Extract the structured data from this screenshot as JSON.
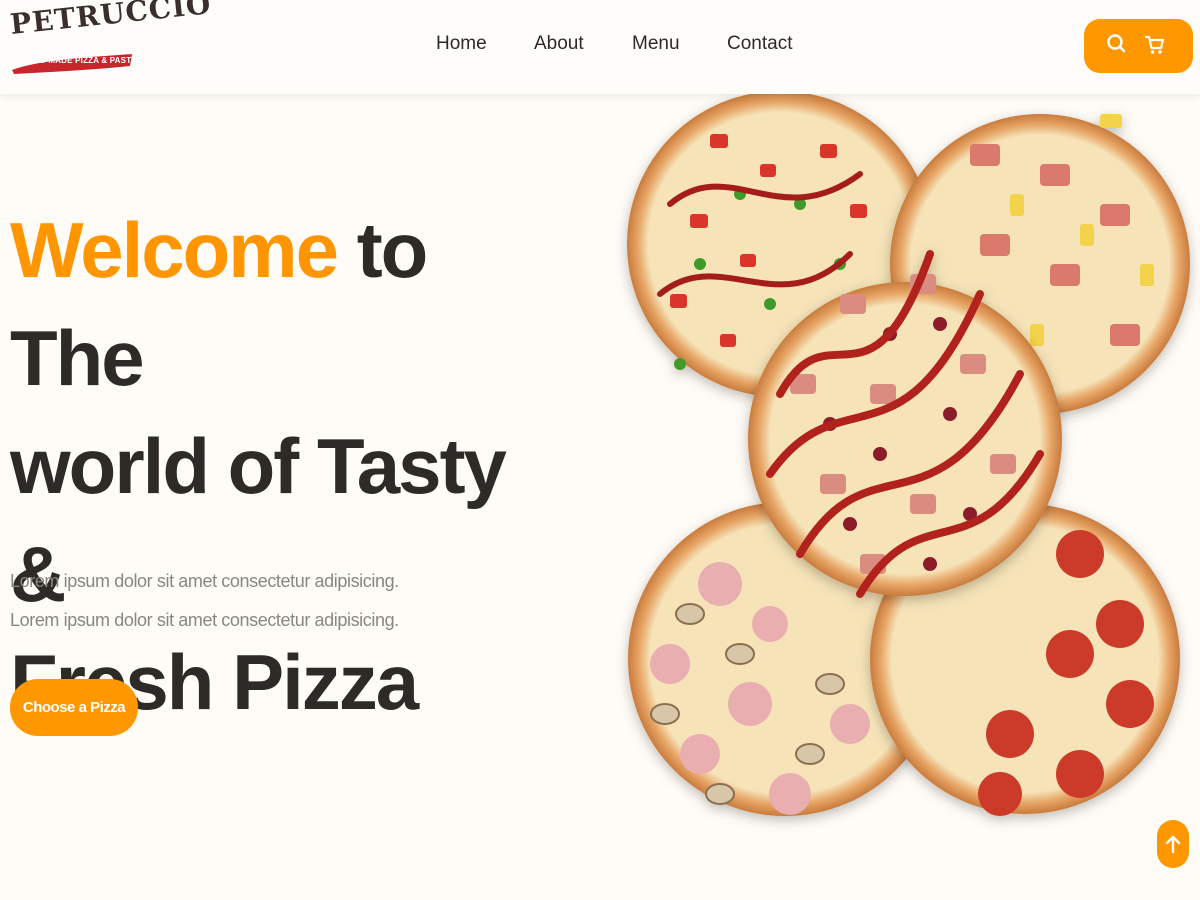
{
  "brand": {
    "name": "PETRUCCIO",
    "tagline": "HAND MADE PIZZA & PASTA"
  },
  "nav": {
    "items": [
      {
        "label": "Home"
      },
      {
        "label": "About"
      },
      {
        "label": "Menu"
      },
      {
        "label": "Contact"
      }
    ]
  },
  "header_actions": {
    "icons": [
      "search-icon",
      "cart-icon"
    ]
  },
  "hero": {
    "title_accent": "Welcome",
    "title_line1_rest": " to The",
    "title_line2": "world of Tasty &",
    "title_line3": "Fresh Pizza",
    "text_line1": "Lorem ipsum dolor sit amet consectetur adipisicing.",
    "text_line2": "Lorem ipsum dolor sit amet consectetur adipisicing.",
    "cta_label": "Choose a Pizza"
  },
  "scroll_top": {
    "icon": "arrow-up-icon"
  },
  "colors": {
    "accent": "#ff9700",
    "heading": "#2c2b27",
    "body_text": "#8a8781",
    "background": "#fffbf6"
  }
}
